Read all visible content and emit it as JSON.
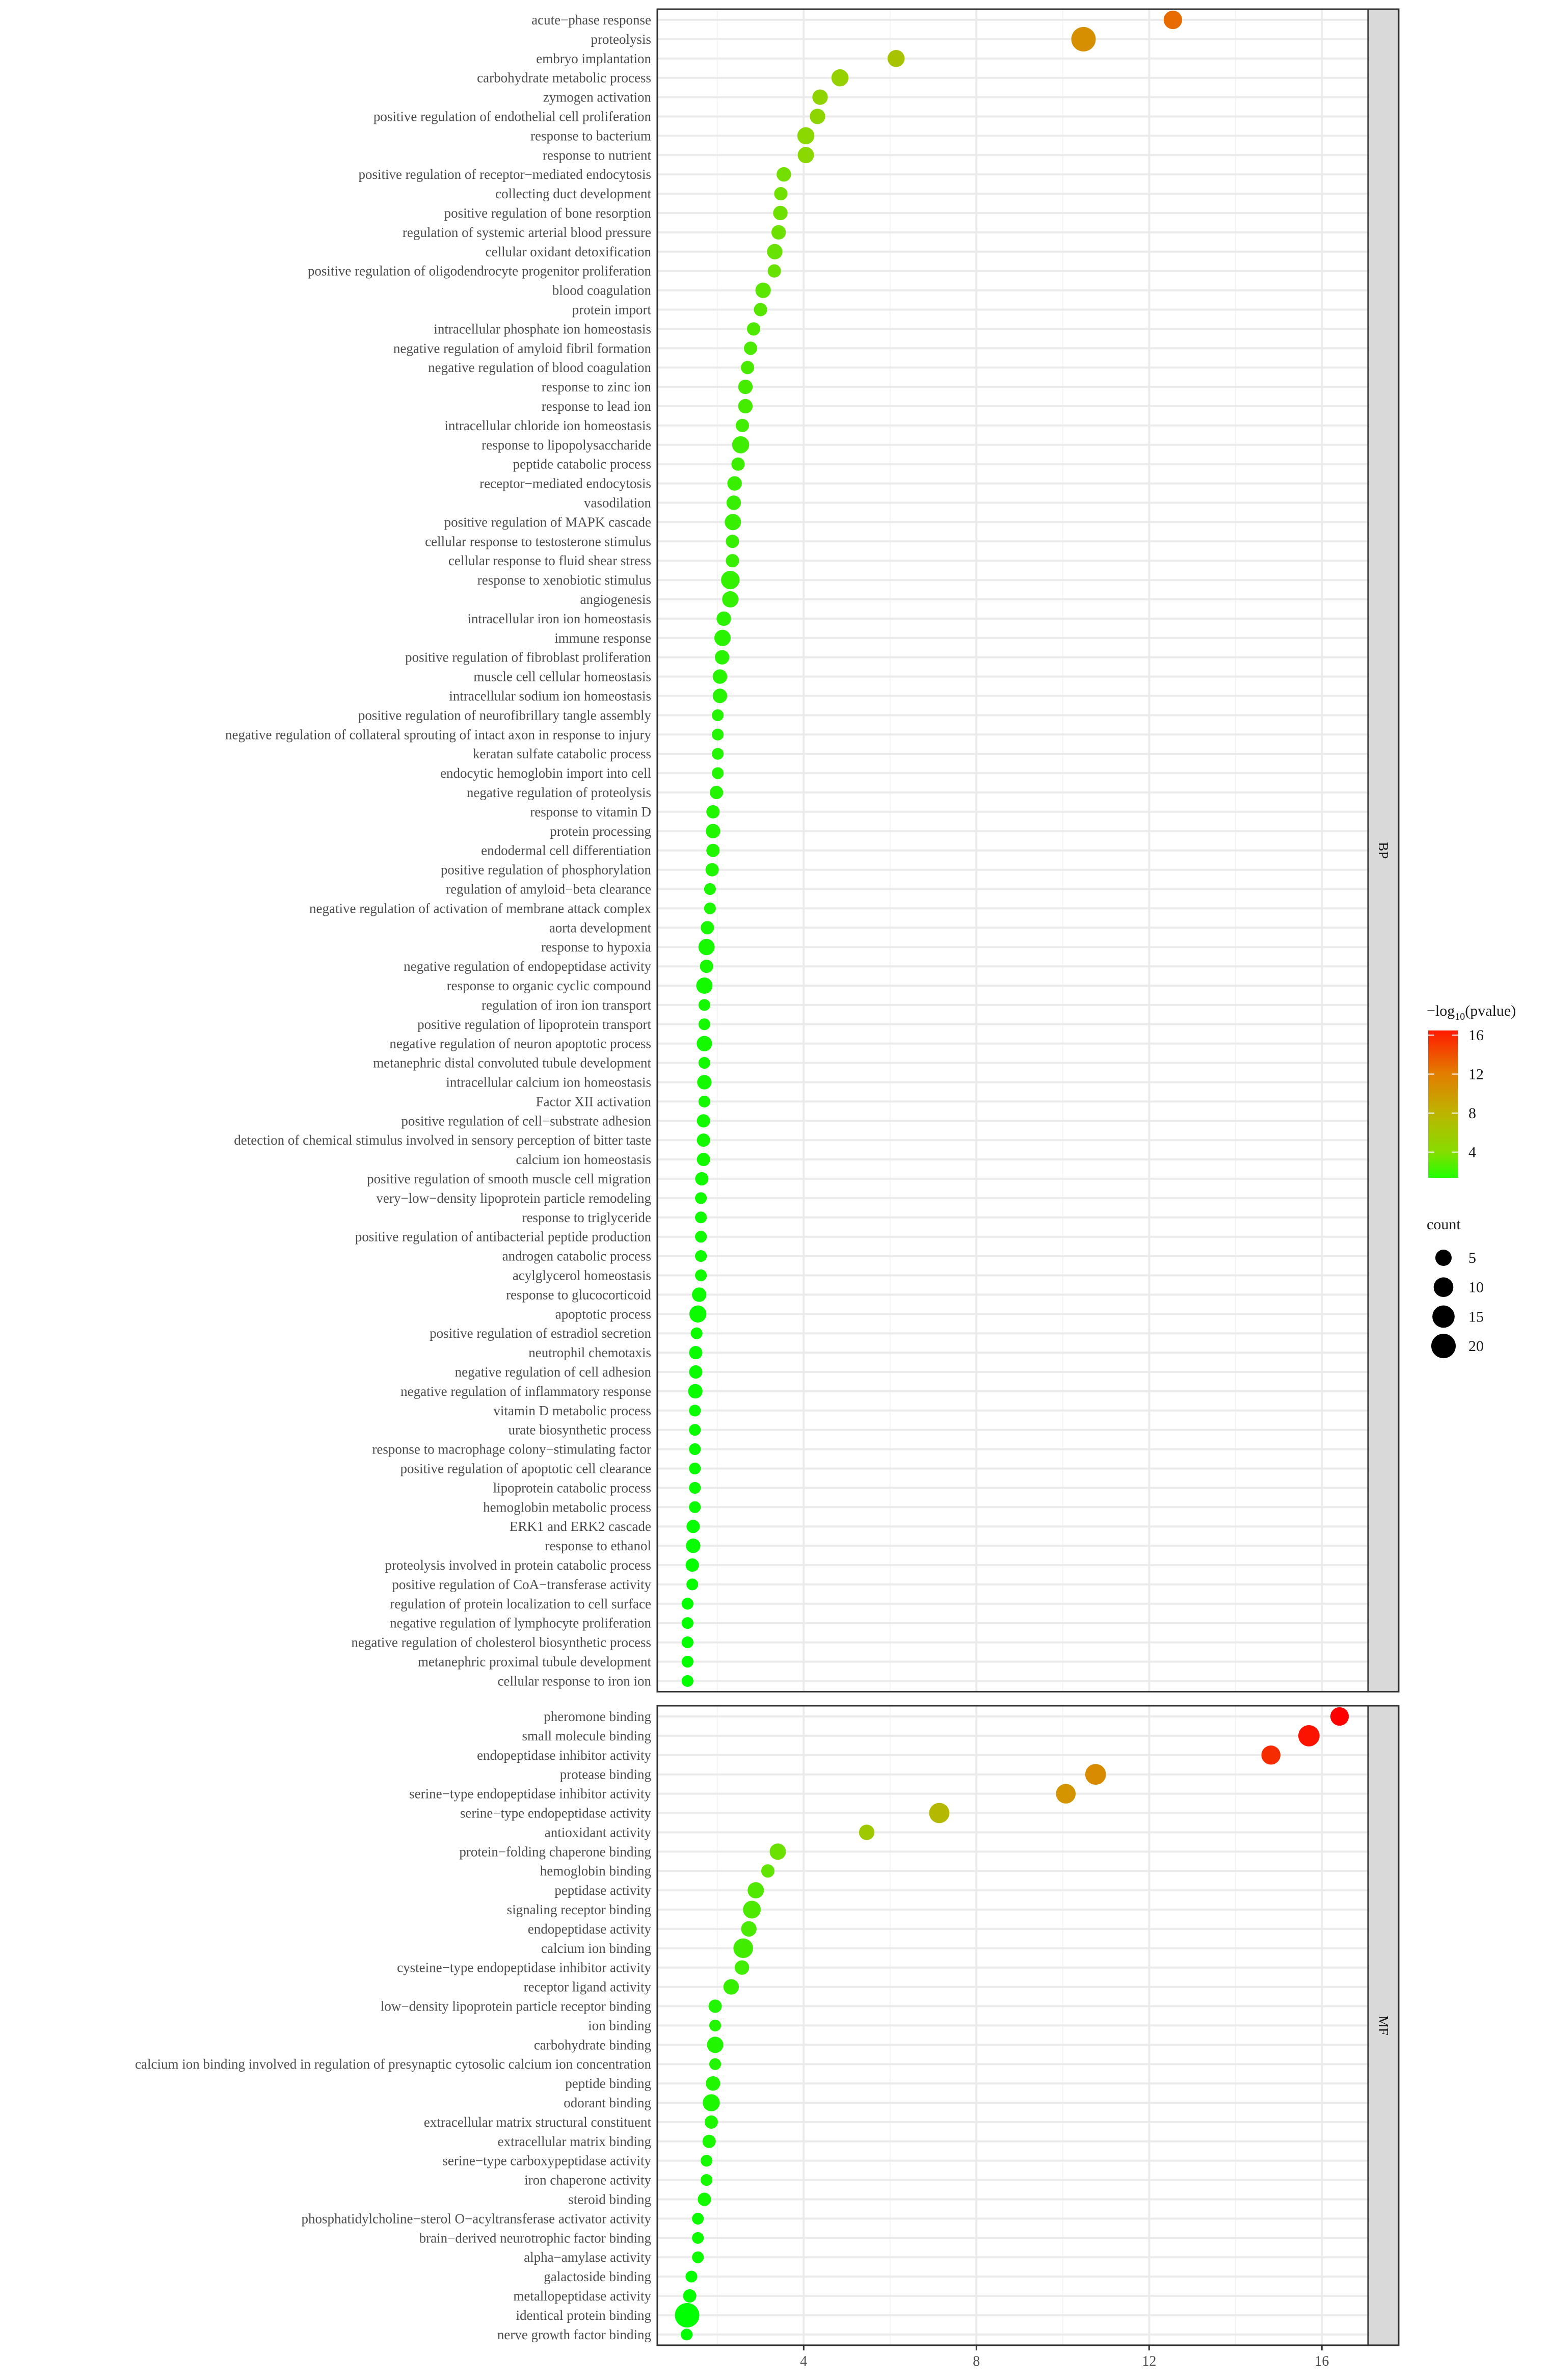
{
  "chart_data": {
    "type": "scatter",
    "subtype": "dot plot (GO enrichment)",
    "xlabel": "",
    "ylabel": "",
    "xlim": [
      0.61,
      17.07
    ],
    "x_ticks": [
      4,
      8,
      12,
      16
    ],
    "grid": true,
    "color_variable": "-log10(pvalue)",
    "size_variable": "count",
    "legend_placement": "right",
    "color_scale": {
      "low": "#00ff00",
      "high": "#ff0000",
      "range": [
        1.3,
        16.4
      ]
    },
    "legend": {
      "color_title_main": "−log",
      "color_title_sub": "10",
      "color_title_tail": "(pvalue)",
      "color_ticks": [
        4,
        8,
        12,
        16
      ],
      "size_title": "count",
      "size_breaks": [
        5,
        10,
        15,
        20
      ]
    },
    "facets": [
      {
        "name": "BP",
        "points": [
          [
            "acute−phase response",
            12.55,
            8
          ],
          [
            "proteolysis",
            10.48,
            20
          ],
          [
            "embryo implantation",
            6.14,
            6
          ],
          [
            "carbohydrate metabolic process",
            4.84,
            6
          ],
          [
            "zymogen activation",
            4.38,
            4
          ],
          [
            "positive regulation of endothelial cell proliferation",
            4.32,
            4
          ],
          [
            "response to bacterium",
            4.05,
            6
          ],
          [
            "response to nutrient",
            4.05,
            5
          ],
          [
            "positive regulation of receptor−mediated endocytosis",
            3.54,
            3
          ],
          [
            "collecting duct development",
            3.47,
            2
          ],
          [
            "positive regulation of bone resorption",
            3.46,
            3
          ],
          [
            "regulation of systemic arterial blood pressure",
            3.42,
            3
          ],
          [
            "cellular oxidant detoxification",
            3.33,
            4
          ],
          [
            "positive regulation of oligodendrocyte progenitor proliferation",
            3.32,
            2
          ],
          [
            "blood coagulation",
            3.06,
            4
          ],
          [
            "protein import",
            3.0,
            2
          ],
          [
            "intracellular phosphate ion homeostasis",
            2.84,
            2
          ],
          [
            "negative regulation of amyloid fibril formation",
            2.77,
            2
          ],
          [
            "negative regulation of blood coagulation",
            2.7,
            2
          ],
          [
            "response to zinc ion",
            2.65,
            3
          ],
          [
            "response to lead ion",
            2.65,
            3
          ],
          [
            "intracellular chloride ion homeostasis",
            2.58,
            2
          ],
          [
            "response to lipopolysaccharide",
            2.54,
            6
          ],
          [
            "peptide catabolic process",
            2.48,
            2
          ],
          [
            "receptor−mediated endocytosis",
            2.4,
            3
          ],
          [
            "vasodilation",
            2.38,
            3
          ],
          [
            "positive regulation of MAPK cascade",
            2.36,
            5
          ],
          [
            "cellular response to testosterone stimulus",
            2.35,
            2
          ],
          [
            "cellular response to fluid shear stress",
            2.35,
            2
          ],
          [
            "response to xenobiotic stimulus",
            2.3,
            8
          ],
          [
            "angiogenesis",
            2.3,
            5
          ],
          [
            "intracellular iron ion homeostasis",
            2.15,
            3
          ],
          [
            "immune response",
            2.12,
            5
          ],
          [
            "positive regulation of fibroblast proliferation",
            2.11,
            3
          ],
          [
            "muscle cell cellular homeostasis",
            2.06,
            3
          ],
          [
            "intracellular sodium ion homeostasis",
            2.06,
            3
          ],
          [
            "positive regulation of neurofibrillary tangle assembly",
            2.01,
            1
          ],
          [
            "negative regulation of collateral sprouting of intact axon in response to injury",
            2.01,
            1
          ],
          [
            "keratan sulfate catabolic process",
            2.01,
            1
          ],
          [
            "endocytic hemoglobin import into cell",
            2.01,
            1
          ],
          [
            "negative regulation of proteolysis",
            1.98,
            2
          ],
          [
            "response to vitamin D",
            1.9,
            2
          ],
          [
            "protein processing",
            1.9,
            3
          ],
          [
            "endodermal cell differentiation",
            1.9,
            2
          ],
          [
            "positive regulation of phosphorylation",
            1.88,
            2
          ],
          [
            "regulation of amyloid−beta clearance",
            1.83,
            1
          ],
          [
            "negative regulation of activation of membrane attack complex",
            1.83,
            1
          ],
          [
            "aorta development",
            1.77,
            2
          ],
          [
            "response to hypoxia",
            1.75,
            5
          ],
          [
            "negative regulation of endopeptidase activity",
            1.75,
            2
          ],
          [
            "response to organic cyclic compound",
            1.7,
            5
          ],
          [
            "regulation of iron ion transport",
            1.7,
            1
          ],
          [
            "positive regulation of lipoprotein transport",
            1.7,
            1
          ],
          [
            "negative regulation of neuron apoptotic process",
            1.7,
            4
          ],
          [
            "metanephric distal convoluted tubule development",
            1.7,
            1
          ],
          [
            "intracellular calcium ion homeostasis",
            1.7,
            3
          ],
          [
            "Factor XII activation",
            1.7,
            1
          ],
          [
            "positive regulation of cell−substrate adhesion",
            1.68,
            2
          ],
          [
            "detection of chemical stimulus involved in sensory perception of bitter taste",
            1.68,
            2
          ],
          [
            "calcium ion homeostasis",
            1.68,
            2
          ],
          [
            "positive regulation of smooth muscle cell migration",
            1.64,
            2
          ],
          [
            "very−low−density lipoprotein particle remodeling",
            1.62,
            1
          ],
          [
            "response to triglyceride",
            1.62,
            1
          ],
          [
            "positive regulation of antibacterial peptide production",
            1.62,
            1
          ],
          [
            "androgen catabolic process",
            1.62,
            1
          ],
          [
            "acylglycerol homeostasis",
            1.62,
            1
          ],
          [
            "response to glucocorticoid",
            1.58,
            3
          ],
          [
            "apoptotic process",
            1.55,
            6
          ],
          [
            "positive regulation of estradiol secretion",
            1.52,
            1
          ],
          [
            "neutrophil chemotaxis",
            1.5,
            2
          ],
          [
            "negative regulation of cell adhesion",
            1.5,
            2
          ],
          [
            "negative regulation of inflammatory response",
            1.49,
            3
          ],
          [
            "vitamin D metabolic process",
            1.48,
            1
          ],
          [
            "urate biosynthetic process",
            1.48,
            1
          ],
          [
            "response to macrophage colony−stimulating factor",
            1.48,
            1
          ],
          [
            "positive regulation of apoptotic cell clearance",
            1.48,
            1
          ],
          [
            "lipoprotein catabolic process",
            1.48,
            1
          ],
          [
            "hemoglobin metabolic process",
            1.48,
            1
          ],
          [
            "ERK1 and ERK2 cascade",
            1.44,
            2
          ],
          [
            "response to ethanol",
            1.44,
            3
          ],
          [
            "proteolysis involved in protein catabolic process",
            1.42,
            2
          ],
          [
            "positive regulation of CoA−transferase activity",
            1.42,
            1
          ],
          [
            "regulation of protein localization to cell surface",
            1.31,
            1
          ],
          [
            "negative regulation of lymphocyte proliferation",
            1.31,
            1
          ],
          [
            "negative regulation of cholesterol biosynthetic process",
            1.31,
            1
          ],
          [
            "metanephric proximal tubule development",
            1.31,
            1
          ],
          [
            "cellular response to iron ion",
            1.31,
            1
          ]
        ]
      },
      {
        "name": "MF",
        "points": [
          [
            "pheromone binding",
            16.41,
            8
          ],
          [
            "small molecule binding",
            15.7,
            13
          ],
          [
            "endopeptidase inhibitor activity",
            14.82,
            9
          ],
          [
            "protease binding",
            10.76,
            12
          ],
          [
            "serine−type endopeptidase inhibitor activity",
            10.07,
            10
          ],
          [
            "serine−type endopeptidase activity",
            7.14,
            11
          ],
          [
            "antioxidant activity",
            5.46,
            4
          ],
          [
            "protein−folding chaperone binding",
            3.4,
            5
          ],
          [
            "hemoglobin binding",
            3.17,
            2
          ],
          [
            "peptidase activity",
            2.89,
            5
          ],
          [
            "signaling receptor binding",
            2.8,
            7
          ],
          [
            "endopeptidase activity",
            2.73,
            4
          ],
          [
            "calcium ion binding",
            2.6,
            10
          ],
          [
            "cysteine−type endopeptidase inhibitor activity",
            2.57,
            3
          ],
          [
            "receptor ligand activity",
            2.32,
            4
          ],
          [
            "low−density lipoprotein particle receptor binding",
            1.95,
            2
          ],
          [
            "ion binding",
            1.95,
            1
          ],
          [
            "carbohydrate binding",
            1.95,
            5
          ],
          [
            "calcium ion binding involved in regulation of presynaptic cytosolic calcium ion concentration",
            1.95,
            1
          ],
          [
            "peptide binding",
            1.9,
            3
          ],
          [
            "odorant binding",
            1.86,
            6
          ],
          [
            "extracellular matrix structural constituent",
            1.86,
            2
          ],
          [
            "extracellular matrix binding",
            1.81,
            2
          ],
          [
            "serine−type carboxypeptidase activity",
            1.75,
            1
          ],
          [
            "iron chaperone activity",
            1.75,
            1
          ],
          [
            "steroid binding",
            1.7,
            2
          ],
          [
            "phosphatidylcholine−sterol O−acyltransferase activator activity",
            1.55,
            1
          ],
          [
            "brain−derived neurotrophic factor binding",
            1.55,
            1
          ],
          [
            "alpha−amylase activity",
            1.55,
            1
          ],
          [
            "galactoside binding",
            1.4,
            1
          ],
          [
            "metallopeptidase activity",
            1.36,
            2
          ],
          [
            "identical protein binding",
            1.3,
            20
          ],
          [
            "nerve growth factor binding",
            1.29,
            1
          ]
        ]
      }
    ]
  }
}
